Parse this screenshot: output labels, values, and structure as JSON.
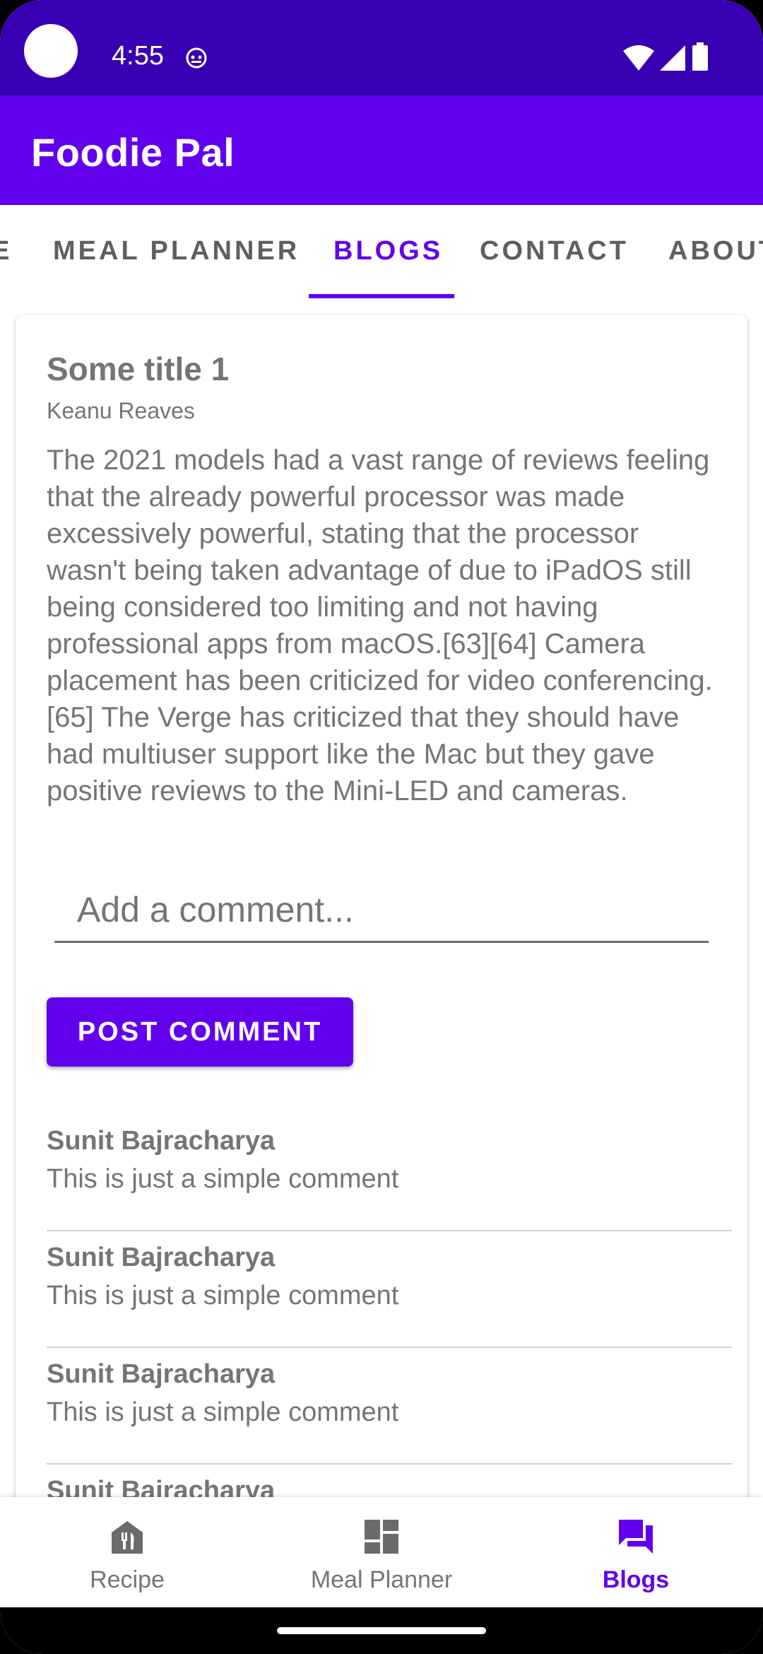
{
  "status_bar": {
    "time": "4:55"
  },
  "app_bar": {
    "title": "Foodie Pal"
  },
  "tabs": [
    {
      "label": "E"
    },
    {
      "label": "MEAL PLANNER"
    },
    {
      "label": "BLOGS"
    },
    {
      "label": "CONTACT"
    },
    {
      "label": "ABOUT"
    }
  ],
  "post": {
    "title": "Some title 1",
    "author": "Keanu Reaves",
    "body": "The 2021 models had a vast range of reviews feeling that the already powerful processor was made excessively powerful, stating that the processor wasn't being taken advantage of due to iPadOS still being considered too limiting and not having professional apps from macOS.[63][64] Camera placement has been criticized for video conferencing.[65] The Verge has criticized that they should have had multiuser support like the Mac but they gave positive reviews to the Mini-LED and cameras.",
    "comment_placeholder": "Add a comment...",
    "post_button": "POST COMMENT"
  },
  "comments": [
    {
      "author": "Sunit Bajracharya",
      "text": "This is just a simple comment"
    },
    {
      "author": "Sunit Bajracharya",
      "text": "This is just a simple comment"
    },
    {
      "author": "Sunit Bajracharya",
      "text": "This is just a simple comment"
    },
    {
      "author": "Sunit Bajracharya",
      "text": ""
    }
  ],
  "bottom_nav": [
    {
      "label": "Recipe",
      "icon": "restaurant-icon"
    },
    {
      "label": "Meal Planner",
      "icon": "dashboard-icon"
    },
    {
      "label": "Blogs",
      "icon": "forum-icon"
    }
  ],
  "colors": {
    "primary": "#6200ee",
    "primary_dark": "#3700b3",
    "text_gray": "#757575"
  }
}
